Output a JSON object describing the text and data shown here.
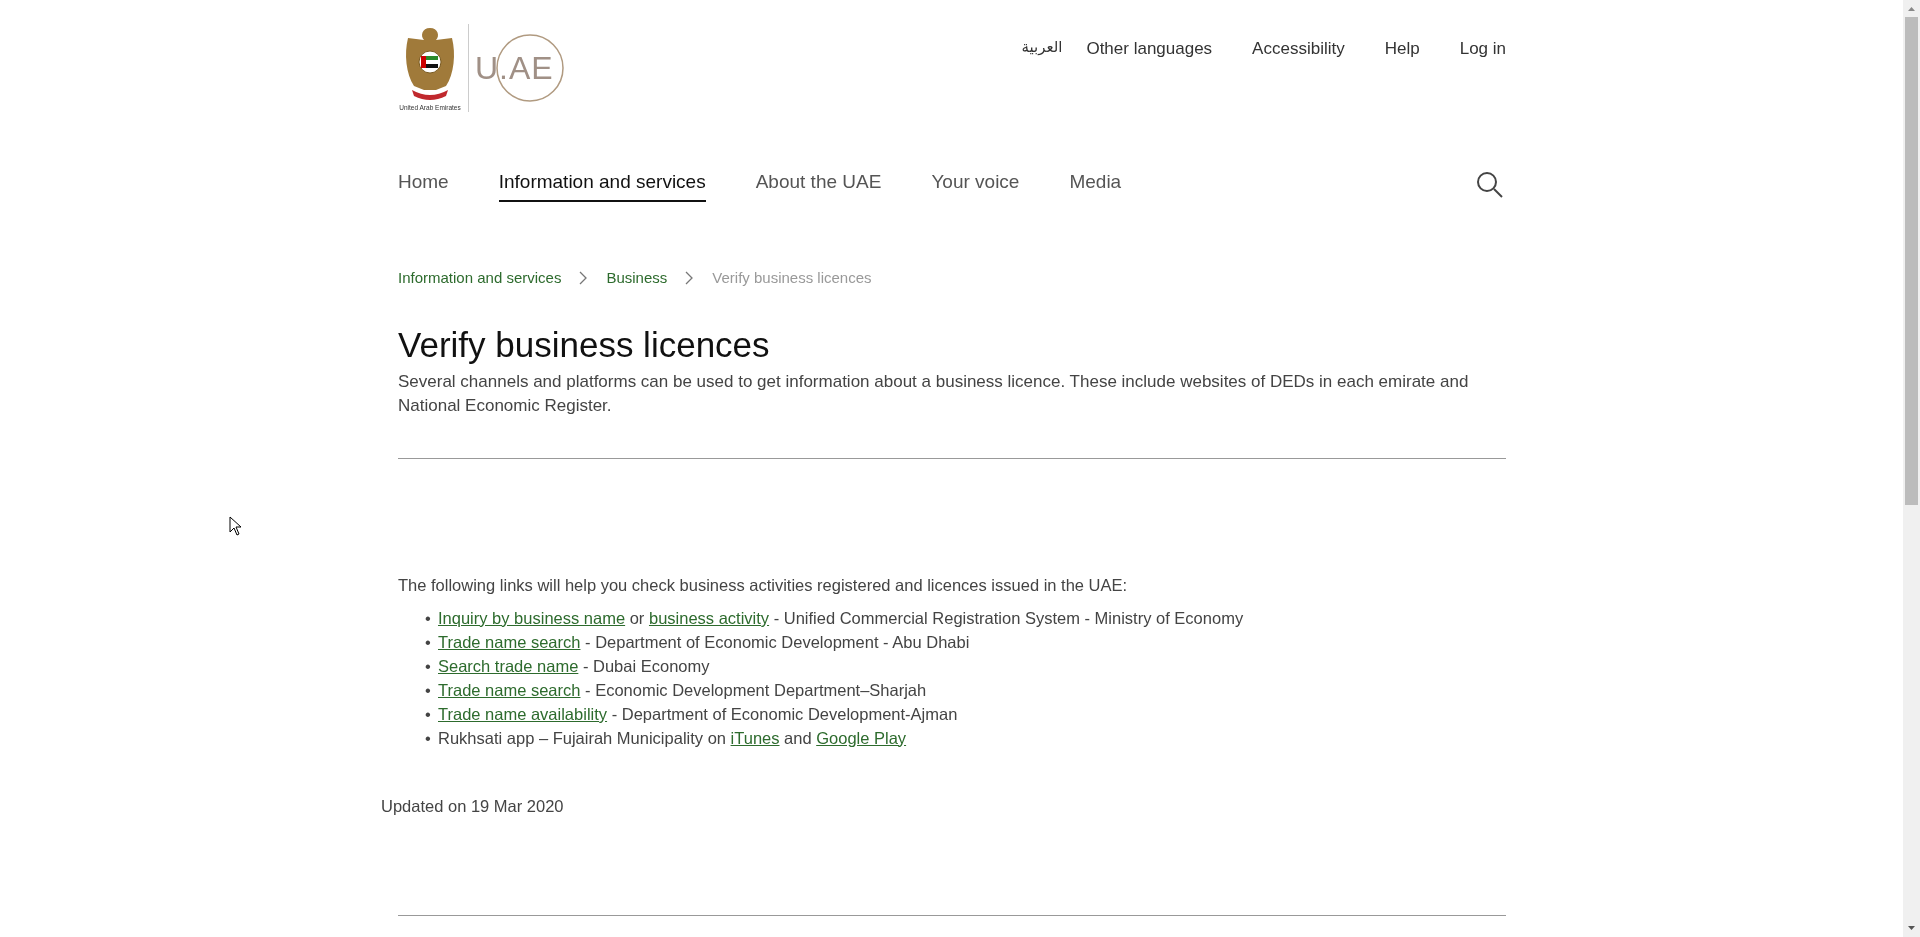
{
  "logo": {
    "emblem_caption": "United Arab Emirates",
    "wordmark": "U.AE"
  },
  "top_links": [
    {
      "label": "العربية"
    },
    {
      "label": "Other languages"
    },
    {
      "label": "Accessibility"
    },
    {
      "label": "Help"
    },
    {
      "label": "Log in"
    }
  ],
  "main_nav": [
    {
      "label": "Home",
      "selected": false
    },
    {
      "label": "Information and services",
      "selected": true
    },
    {
      "label": "About the UAE",
      "selected": false
    },
    {
      "label": "Your voice",
      "selected": false
    },
    {
      "label": "Media",
      "selected": false
    }
  ],
  "breadcrumb": [
    {
      "label": "Information and services",
      "kind": "link"
    },
    {
      "label": "Business",
      "kind": "link"
    },
    {
      "label": "Verify business licences",
      "kind": "current"
    }
  ],
  "title": "Verify business licences",
  "summary": "Several channels and platforms can be used to get information about a business licence. These include websites of DEDs in each emirate and National Economic Register.",
  "intro": "The following links will help you check business activities registered and licences issued in the UAE:",
  "links_list": [
    {
      "marker": "•",
      "parts": [
        {
          "kind": "link",
          "text": "Inquiry by business name"
        },
        {
          "kind": "text",
          "text": " or "
        },
        {
          "kind": "link",
          "text": "business activity"
        },
        {
          "kind": "text",
          "text": " - Unified Commercial Registration System - Ministry of Economy"
        }
      ]
    },
    {
      "marker": "•",
      "parts": [
        {
          "kind": "link",
          "text": "Trade name search"
        },
        {
          "kind": "text",
          "text": " - Department of Economic Development - Abu Dhabi"
        }
      ]
    },
    {
      "marker": "•",
      "parts": [
        {
          "kind": "link",
          "text": "Search trade name"
        },
        {
          "kind": "text",
          "text": " - Dubai Economy"
        }
      ]
    },
    {
      "marker": "•",
      "parts": [
        {
          "kind": "link",
          "text": "Trade name search"
        },
        {
          "kind": "text",
          "text": " - Economic Development Department–Sharjah"
        }
      ]
    },
    {
      "marker": "•",
      "parts": [
        {
          "kind": "link",
          "text": "Trade name availability"
        },
        {
          "kind": "text",
          "text": " - Department of Economic Development-Ajman"
        }
      ]
    },
    {
      "marker": "•",
      "parts": [
        {
          "kind": "text",
          "text": "Rukhsati app – Fujairah Municipality on "
        },
        {
          "kind": "link",
          "text": "iTunes"
        },
        {
          "kind": "text",
          "text": " and "
        },
        {
          "kind": "link",
          "text": "Google Play"
        }
      ]
    }
  ],
  "updated": "Updated on 19 Mar 2020"
}
